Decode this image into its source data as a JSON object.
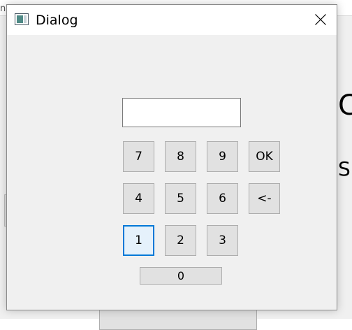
{
  "background": {
    "topbar_text": "n",
    "big_letter": "C",
    "small_letter": "S"
  },
  "dialog": {
    "title": "Dialog",
    "display_value": "",
    "keys": {
      "k7": "7",
      "k8": "8",
      "k9": "9",
      "ok": "OK",
      "k4": "4",
      "k5": "5",
      "k6": "6",
      "backspace": "<-",
      "k1": "1",
      "k2": "2",
      "k3": "3",
      "k0": "0"
    },
    "focused_key": "1"
  },
  "colors": {
    "focus_border": "#0078d7",
    "button_face": "#e1e1e1",
    "dialog_bg": "#f0f0f0"
  },
  "icons": {
    "app": "dialog-app-icon",
    "close": "close-icon"
  }
}
